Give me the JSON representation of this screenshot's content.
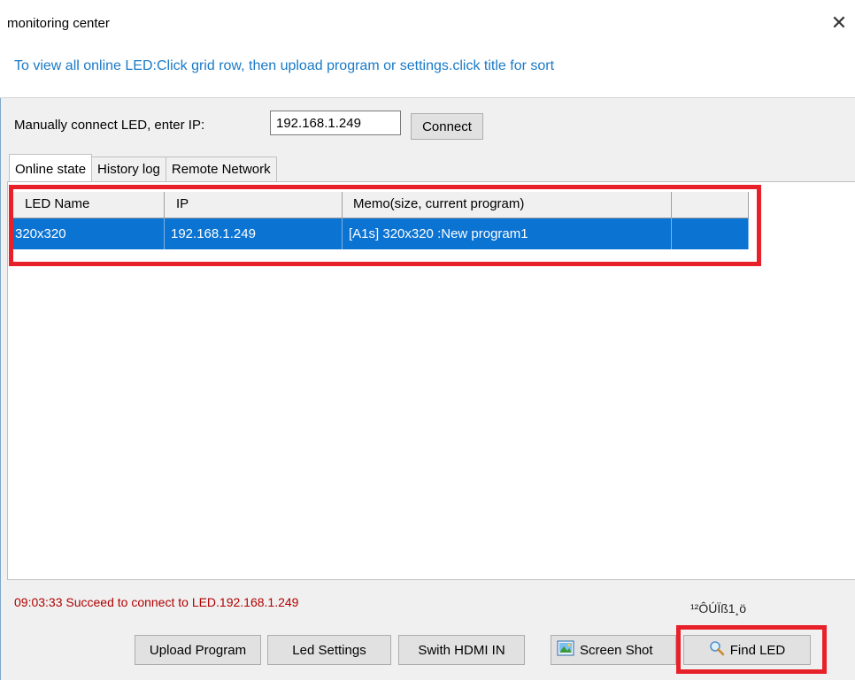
{
  "window": {
    "title": "monitoring center",
    "close_glyph": "✕",
    "info_text": "To view all online LED:Click grid row, then upload program or settings.click title for sort"
  },
  "connect": {
    "label": "Manually connect LED, enter IP:",
    "ip_value": "192.168.1.249",
    "button_label": "Connect"
  },
  "tabs": [
    {
      "label": "Online state",
      "active": true
    },
    {
      "label": "History log",
      "active": false
    },
    {
      "label": "Remote Network",
      "active": false
    }
  ],
  "grid": {
    "columns": [
      "LED Name",
      "IP",
      "Memo(size, current program)",
      ""
    ],
    "rows": [
      {
        "name": "320x320",
        "ip": "192.168.1.249",
        "memo": "[A1s] 320x320 :New program1",
        "extra": "",
        "selected": true
      }
    ]
  },
  "status": {
    "message": "09:03:33  Succeed to connect to LED.192.168.1.249",
    "garbled_text": "¹²ÔÚÏß1¸ö"
  },
  "buttons": {
    "upload": "Upload Program",
    "settings": "Led Settings",
    "hdmi": "Swith HDMI IN",
    "screenshot": "Screen Shot",
    "find": "Find LED"
  },
  "icons": {
    "screenshot": "picture-icon",
    "find": "magnifier-icon"
  },
  "colors": {
    "info_text": "#1a7ac7",
    "selected_row": "#0b73d2",
    "status_text": "#b00000",
    "highlight": "#e8202a"
  }
}
